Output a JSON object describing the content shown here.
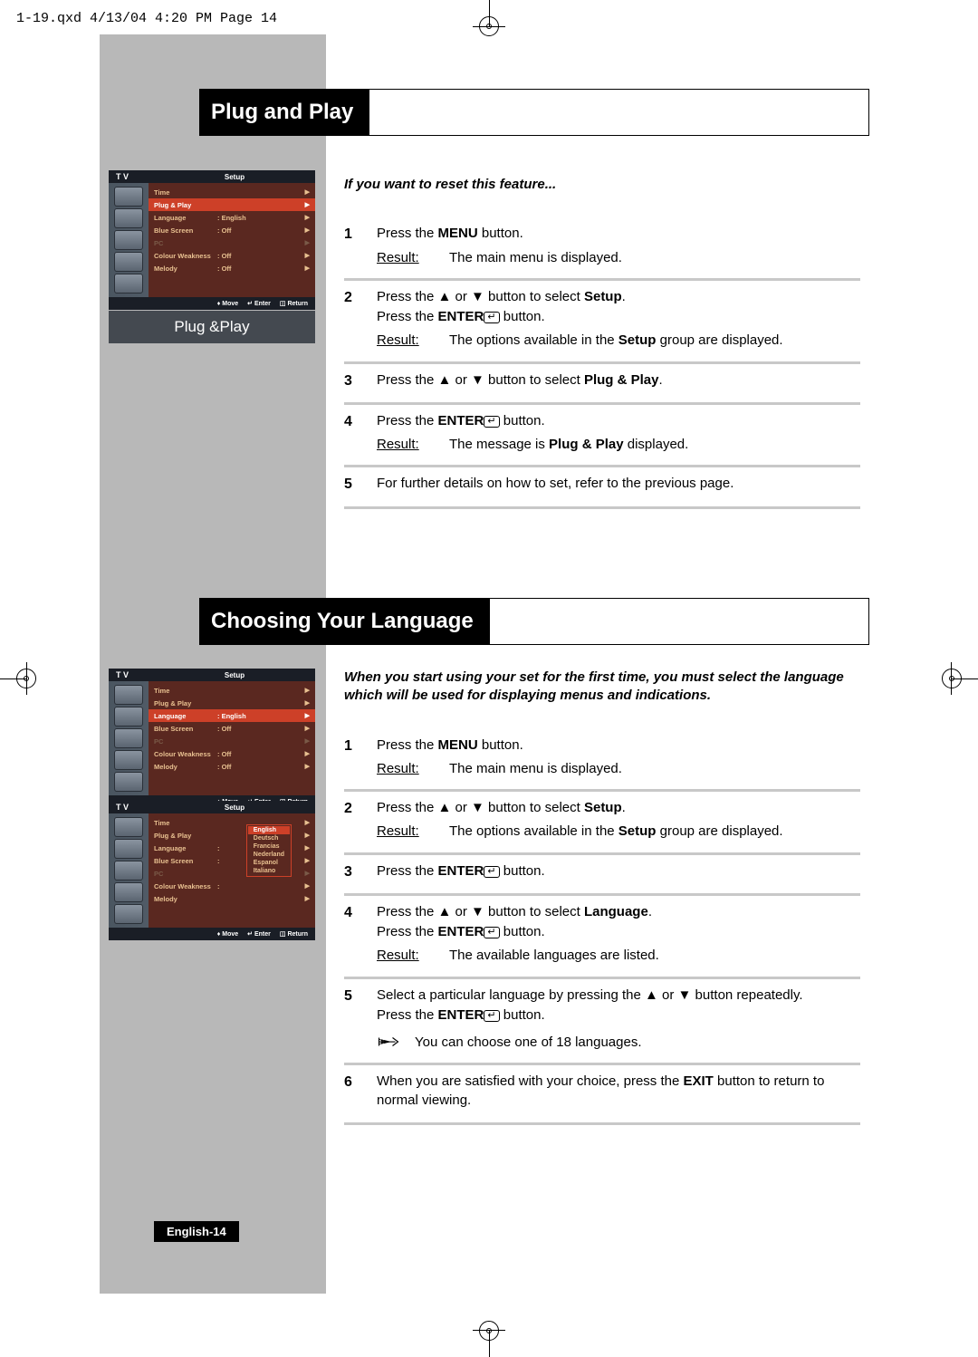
{
  "page_header": "1-19.qxd  4/13/04 4:20 PM  Page 14",
  "footer": "English-14",
  "section1": {
    "title": "Plug and Play",
    "intro": "If you want to reset this feature...",
    "osd": {
      "tv_label": "T V",
      "setup_label": "Setup",
      "rows": [
        {
          "k": "Time",
          "v": "",
          "hl": false
        },
        {
          "k": "Plug & Play",
          "v": "",
          "hl": true
        },
        {
          "k": "Language",
          "v": ": English",
          "hl": false
        },
        {
          "k": "Blue Screen",
          "v": ": Off",
          "hl": false
        },
        {
          "k": "PC",
          "v": "",
          "hl": false,
          "dim": true
        },
        {
          "k": "Colour Weakness",
          "v": ": Off",
          "hl": false
        },
        {
          "k": "Melody",
          "v": ": Off",
          "hl": false
        }
      ],
      "bottom": {
        "move": "Move",
        "enter": "Enter",
        "return": "Return"
      }
    },
    "plugplay_label": "Plug &Play",
    "steps": [
      {
        "n": "1",
        "lines": [
          "Press the |MENU| button."
        ],
        "result": "The main menu is displayed."
      },
      {
        "n": "2",
        "lines": [
          "Press the ▲ or ▼ button to select |Setup|.",
          "Press the |ENTER|↵  button."
        ],
        "result": "The options available in the |Setup| group are displayed."
      },
      {
        "n": "3",
        "lines": [
          "Press the ▲ or ▼ button to select |Plug & Play|."
        ]
      },
      {
        "n": "4",
        "lines": [
          "Press the |ENTER|↵  button."
        ],
        "result": "The message is  |Plug & Play| displayed."
      },
      {
        "n": "5",
        "lines": [
          "For further details on how to set, refer to the previous page."
        ]
      }
    ]
  },
  "section2": {
    "title": "Choosing Your Language",
    "intro": "When you start using your set for the first time, you must select the language which will be used for displaying menus and indications.",
    "osd1": {
      "tv_label": "T V",
      "setup_label": "Setup",
      "rows": [
        {
          "k": "Time",
          "v": "",
          "hl": false
        },
        {
          "k": "Plug & Play",
          "v": "",
          "hl": false
        },
        {
          "k": "Language",
          "v": ": English",
          "hl": true
        },
        {
          "k": "Blue Screen",
          "v": ": Off",
          "hl": false
        },
        {
          "k": "PC",
          "v": "",
          "hl": false,
          "dim": true
        },
        {
          "k": "Colour Weakness",
          "v": ": Off",
          "hl": false
        },
        {
          "k": "Melody",
          "v": ": Off",
          "hl": false
        }
      ],
      "bottom": {
        "move": "Move",
        "enter": "Enter",
        "return": "Return"
      }
    },
    "osd2": {
      "tv_label": "T V",
      "setup_label": "Setup",
      "rows": [
        {
          "k": "Time",
          "v": "",
          "hl": false
        },
        {
          "k": "Plug & Play",
          "v": "",
          "hl": false
        },
        {
          "k": "Language",
          "v": ":",
          "hl": false
        },
        {
          "k": "Blue Screen",
          "v": ":",
          "hl": false
        },
        {
          "k": "PC",
          "v": "",
          "hl": false,
          "dim": true
        },
        {
          "k": "Colour Weakness",
          "v": ":",
          "hl": false
        },
        {
          "k": "Melody",
          "v": "",
          "hl": false
        }
      ],
      "langs": [
        "English",
        "Deutsch",
        "Francias",
        "Nederland",
        "Espanol",
        "Italiano"
      ],
      "bottom": {
        "move": "Move",
        "enter": "Enter",
        "return": "Return"
      }
    },
    "steps": [
      {
        "n": "1",
        "lines": [
          "Press the |MENU| button."
        ],
        "result": "The main menu is displayed."
      },
      {
        "n": "2",
        "lines": [
          "Press the ▲ or ▼ button to select |Setup|."
        ],
        "result": "The options available in the |Setup| group are displayed."
      },
      {
        "n": "3",
        "lines": [
          "Press the |ENTER|↵  button."
        ]
      },
      {
        "n": "4",
        "lines": [
          "Press the ▲ or ▼ button to select |Language|.",
          "Press the |ENTER|↵  button."
        ],
        "result": "The available languages are listed."
      },
      {
        "n": "5",
        "lines": [
          "Select a particular language by pressing the ▲ or ▼ button repeatedly.",
          "Press the |ENTER|↵  button."
        ],
        "note": "You can choose one of 18 languages."
      },
      {
        "n": "6",
        "lines": [
          "When you are satisfied with your choice, press the |EXIT| button to return to normal viewing."
        ]
      }
    ]
  }
}
